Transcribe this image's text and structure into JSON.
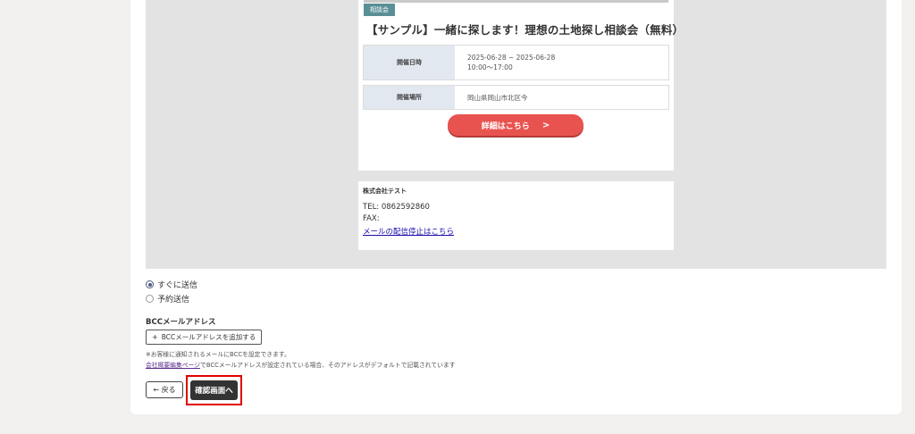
{
  "preview": {
    "event": {
      "tag": "相談会",
      "title": "【サンプル】一緒に探します！理想の土地探し相談会（無料）",
      "rows": [
        {
          "label": "開催日時",
          "line1": "2025-06-28 ~ 2025-06-28",
          "line2": "10:00〜17:00"
        },
        {
          "label": "開催場所",
          "line1": "岡山県岡山市北区今",
          "line2": ""
        }
      ],
      "detail_button": "詳細はこちら",
      "detail_icon": "chevron-right-icon"
    },
    "footer": {
      "company": "株式会社テスト",
      "tel": "TEL: 0862592860",
      "fax": "FAX:",
      "unsubscribe": "メールの配信停止はこちら"
    }
  },
  "send_options": {
    "immediate": "すぐに送信",
    "scheduled": "予約送信",
    "selected": "immediate"
  },
  "bcc": {
    "label": "BCCメールアドレス",
    "add_button": "BCCメールアドレスを追加する",
    "note1": "※お客様に通知されるメールにBCCを設定できます。",
    "note2_link": "会社概要編集ページ",
    "note2_text": "でBCCメールアドレスが設定されている場合、そのアドレスがデフォルトで記載されています"
  },
  "actions": {
    "back": "← 戻る",
    "confirm": "確認画面へ"
  },
  "colors": {
    "accent_red": "#e9534f",
    "tag_teal": "#5b8f96",
    "highlight": "#e00000"
  }
}
